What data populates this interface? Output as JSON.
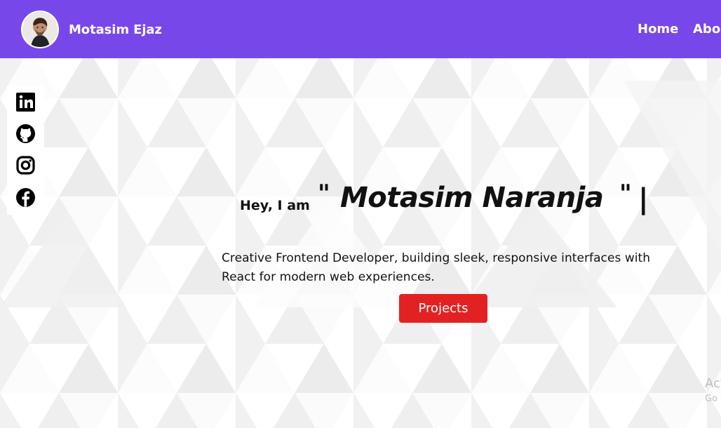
{
  "navbar": {
    "brand_name": "Motasim Ejaz",
    "links": [
      {
        "label": "Home"
      },
      {
        "label": "About"
      }
    ],
    "background_color": "#7847ea"
  },
  "social_links": [
    {
      "icon": "linkedin-icon"
    },
    {
      "icon": "github-icon"
    },
    {
      "icon": "instagram-icon"
    },
    {
      "icon": "facebook-icon"
    }
  ],
  "hero": {
    "prefix": "Hey, I am",
    "quote_open": "\"",
    "name": "Motasim Naranja",
    "quote_close": "\"",
    "cursor": "|",
    "description": "Creative Frontend Developer, building sleek, responsive interfaces with React for modern web experiences.",
    "button_label": "Projects",
    "button_color": "#e22222"
  },
  "watermark": {
    "line1": "Act",
    "line2": "Go t"
  }
}
